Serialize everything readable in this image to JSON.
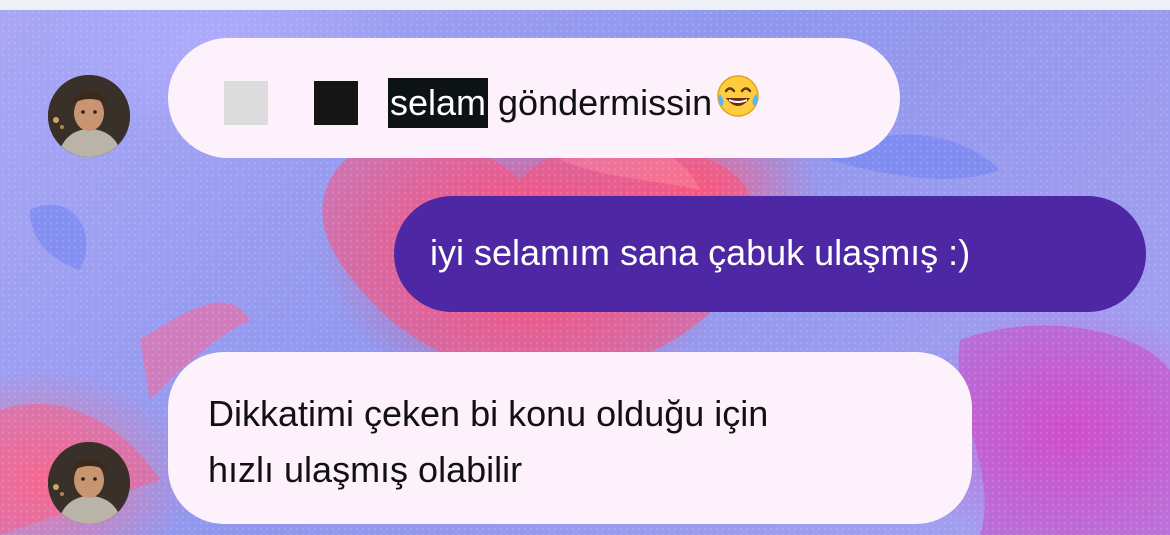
{
  "chat": {
    "messages": [
      {
        "from": "them",
        "redacted_light_color": "#dcdcdc",
        "redacted_dark_color": "#151515",
        "highlight_text": "selam",
        "text": "göndermissin",
        "emoji": "face-with-tears-of-joy"
      },
      {
        "from": "me",
        "text": "iyi selamım sana çabuk ulaşmış :)"
      },
      {
        "from": "them",
        "lines": [
          "Dikkatimi çeken bi konu olduğu için",
          "hızlı ulaşmış olabilir"
        ]
      }
    ],
    "avatar_icon": "user-avatar",
    "colors": {
      "incoming_bubble": "#fdf2fb",
      "outgoing_bubble": "#4d27a4",
      "highlight": "#0d1215"
    }
  }
}
